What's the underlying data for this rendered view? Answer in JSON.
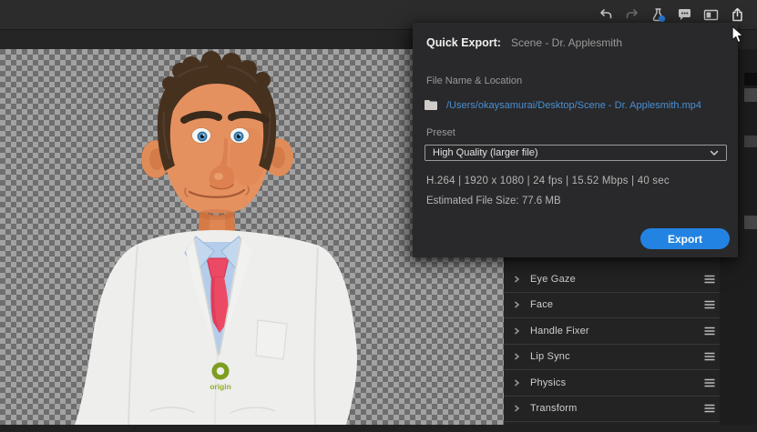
{
  "toolbar": {
    "icons": [
      {
        "name": "undo-icon"
      },
      {
        "name": "redo-icon"
      },
      {
        "name": "beaker-icon"
      },
      {
        "name": "comment-icon"
      },
      {
        "name": "panel-layout-icon"
      },
      {
        "name": "share-export-icon"
      }
    ]
  },
  "quick_export": {
    "title": "Quick Export:",
    "scene_name": "Scene - Dr. Applesmith",
    "file_section_label": "File Name & Location",
    "file_path": "/Users/okaysamurai/Desktop/Scene - Dr. Applesmith.mp4",
    "preset_label": "Preset",
    "preset_value": "High Quality (larger file)",
    "specs": "H.264 | 1920 x 1080 | 24 fps | 15.52 Mbps | 40 sec",
    "estimated_size": "Estimated File Size: 77.6 MB",
    "export_button": "Export",
    "accent_color": "#2283e2",
    "link_color": "#4a8fd3"
  },
  "behaviors_panel": {
    "rows": [
      {
        "label": "Eye Gaze"
      },
      {
        "label": "Face"
      },
      {
        "label": "Handle Fixer"
      },
      {
        "label": "Lip Sync"
      },
      {
        "label": "Physics"
      },
      {
        "label": "Transform"
      }
    ],
    "row_icons": {
      "expand": "chevron-right-icon",
      "menu": "hamburger-menu-icon"
    }
  },
  "scene": {
    "character": "Dr. Applesmith",
    "logo_text": "origin"
  }
}
